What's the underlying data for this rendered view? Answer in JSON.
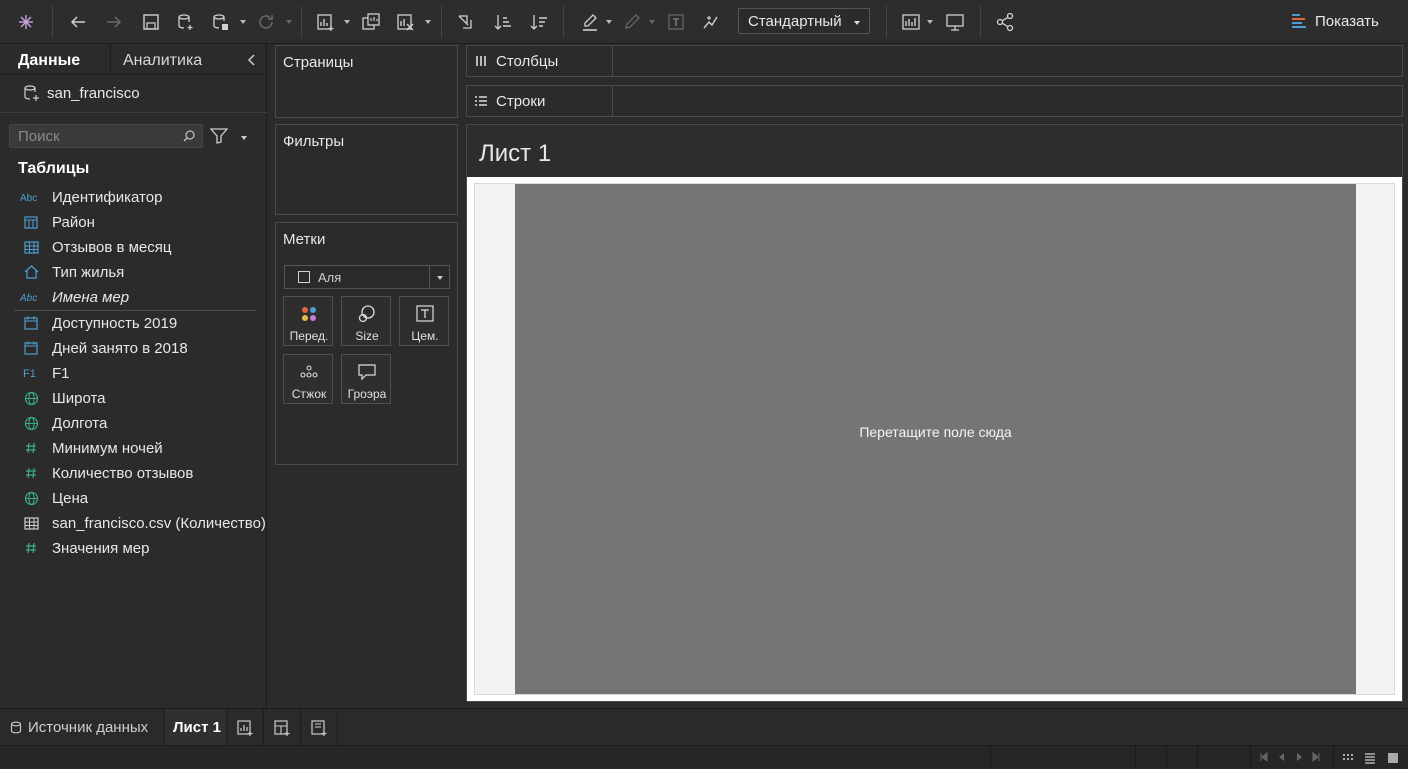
{
  "toolbar": {
    "mark_size_dropdown": "Стандартный",
    "show_me_label": "Показать"
  },
  "data_pane": {
    "tab_data": "Данные",
    "tab_analytics": "Аналитика",
    "data_source": "san_francisco",
    "search_placeholder": "Поиск",
    "tables_header": "Таблицы",
    "fields": [
      {
        "label": "Идентификатор",
        "icon": "abc-icon",
        "role": "dimension"
      },
      {
        "label": "Район",
        "icon": "calendar-icon",
        "role": "dimension"
      },
      {
        "label": "Отзывов в месяц",
        "icon": "table-icon",
        "role": "dimension"
      },
      {
        "label": "Тип жилья",
        "icon": "house-icon",
        "role": "dimension"
      },
      {
        "label": "Имена мер",
        "icon": "abc-icon",
        "role": "dimension",
        "italic": true
      },
      {
        "label": "Доступность 2019",
        "icon": "calendar-icon",
        "role": "measure"
      },
      {
        "label": "Дней занято в 2018",
        "icon": "calendar-icon",
        "role": "measure"
      },
      {
        "label": "F1",
        "icon": "f1-icon",
        "role": "measure"
      },
      {
        "label": "Широта",
        "icon": "globe-icon",
        "role": "measure"
      },
      {
        "label": "Долгота",
        "icon": "globe-icon",
        "role": "measure"
      },
      {
        "label": "Минимум ночей",
        "icon": "hash-icon",
        "role": "measure"
      },
      {
        "label": "Количество отзывов",
        "icon": "hash-icon",
        "role": "measure"
      },
      {
        "label": "Цена",
        "icon": "globe-icon",
        "role": "measure"
      },
      {
        "label": "san_francisco.csv (Количество)",
        "icon": "table-icon",
        "role": "measure"
      },
      {
        "label": "Значения мер",
        "icon": "hash-icon",
        "role": "measure"
      }
    ]
  },
  "cards": {
    "pages": "Страницы",
    "filters": "Фильтры",
    "marks": "Метки",
    "marks_type": "Аля",
    "marks_buttons": [
      "Перед.",
      "Size",
      "Цем.",
      "Стжок",
      "Гроэра"
    ]
  },
  "shelves": {
    "columns": "Столбцы",
    "rows": "Строки"
  },
  "sheet": {
    "title": "Лист 1",
    "drop_text": "Перетащите поле сюда"
  },
  "bottom_tabs": {
    "data_source": "Источник данных",
    "sheet1": "Лист 1"
  },
  "colors": {
    "background": "#2b2b2b",
    "canvas": "#757575",
    "accent_dimension": "#4e9fd1",
    "accent_measure": "#3aab8e"
  }
}
